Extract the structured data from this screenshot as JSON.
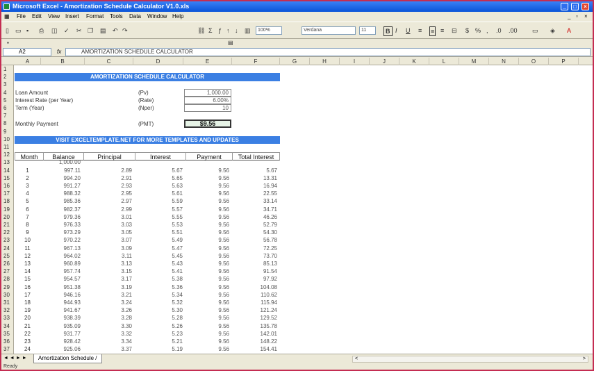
{
  "window": {
    "title": "Microsoft Excel - Amortization Schedule Calculator V1.0.xls"
  },
  "menu": [
    "File",
    "Edit",
    "View",
    "Insert",
    "Format",
    "Tools",
    "Data",
    "Window",
    "Help"
  ],
  "toolbar": {
    "zoom": "100%",
    "font": "Verdana",
    "size": "11"
  },
  "formula_bar": {
    "name_box": "A2",
    "fx": "fx",
    "content": "AMORTIZATION SCHEDULE CALCULATOR"
  },
  "columns": [
    "A",
    "B",
    "C",
    "D",
    "E",
    "F",
    "G",
    "H",
    "I",
    "J",
    "K",
    "L",
    "M",
    "N",
    "O",
    "P"
  ],
  "sheet": {
    "title": "AMORTIZATION SCHEDULE CALCULATOR",
    "loan_label": "Loan Amount",
    "loan_code": "(Pv)",
    "loan_value": "1,000.00",
    "rate_label": "Interest Rate (per Year)",
    "rate_code": "(Rate)",
    "rate_value": "6.00%",
    "term_label": "Term (Year)",
    "term_code": "(Nper)",
    "term_value": "10",
    "pmt_label": "Monthly Payment",
    "pmt_code": "(PMT)",
    "pmt_value": "$9.56",
    "visit": "VISIT EXCELTEMPLATE.NET FOR MORE TEMPLATES AND UPDATES"
  },
  "table": {
    "headers": [
      "Month",
      "Balance",
      "Principal",
      "Interest",
      "Payment",
      "Total Interest"
    ],
    "opening_balance": "1,000.00",
    "rows": [
      [
        "1",
        "997.11",
        "2.89",
        "5.67",
        "9.56",
        "5.67"
      ],
      [
        "2",
        "994.20",
        "2.91",
        "5.65",
        "9.56",
        "13.31"
      ],
      [
        "3",
        "991.27",
        "2.93",
        "5.63",
        "9.56",
        "16.94"
      ],
      [
        "4",
        "988.32",
        "2.95",
        "5.61",
        "9.56",
        "22.55"
      ],
      [
        "5",
        "985.36",
        "2.97",
        "5.59",
        "9.56",
        "33.14"
      ],
      [
        "6",
        "982.37",
        "2.99",
        "5.57",
        "9.56",
        "34.71"
      ],
      [
        "7",
        "979.36",
        "3.01",
        "5.55",
        "9.56",
        "46.26"
      ],
      [
        "8",
        "976.33",
        "3.03",
        "5.53",
        "9.56",
        "52.79"
      ],
      [
        "9",
        "973.29",
        "3.05",
        "5.51",
        "9.56",
        "54.30"
      ],
      [
        "10",
        "970.22",
        "3.07",
        "5.49",
        "9.56",
        "56.78"
      ],
      [
        "11",
        "967.13",
        "3.09",
        "5.47",
        "9.56",
        "72.25"
      ],
      [
        "12",
        "964.02",
        "3.11",
        "5.45",
        "9.56",
        "73.70"
      ],
      [
        "13",
        "960.89",
        "3.13",
        "5.43",
        "9.56",
        "85.13"
      ],
      [
        "14",
        "957.74",
        "3.15",
        "5.41",
        "9.56",
        "91.54"
      ],
      [
        "15",
        "954.57",
        "3.17",
        "5.38",
        "9.56",
        "97.92"
      ],
      [
        "16",
        "951.38",
        "3.19",
        "5.36",
        "9.56",
        "104.08"
      ],
      [
        "17",
        "946.16",
        "3.21",
        "5.34",
        "9.56",
        "110.62"
      ],
      [
        "18",
        "944.93",
        "3.24",
        "5.32",
        "9.56",
        "115.94"
      ],
      [
        "19",
        "941.67",
        "3.26",
        "5.30",
        "9.56",
        "121.24"
      ],
      [
        "20",
        "938.39",
        "3.28",
        "5.28",
        "9.56",
        "129.52"
      ],
      [
        "21",
        "935.09",
        "3.30",
        "5.26",
        "9.56",
        "135.78"
      ],
      [
        "22",
        "931.77",
        "3.32",
        "5.23",
        "9.56",
        "142.01"
      ],
      [
        "23",
        "928.42",
        "3.34",
        "5.21",
        "9.56",
        "148.22"
      ],
      [
        "24",
        "925.06",
        "3.37",
        "5.19",
        "9.56",
        "154.41"
      ]
    ]
  },
  "tabs": {
    "active": "Amortization Schedule /"
  },
  "status": "Ready",
  "colors": {
    "titlebar": "#0a54d8",
    "banner": "#3b7fe3",
    "frame": "#c42d52"
  }
}
